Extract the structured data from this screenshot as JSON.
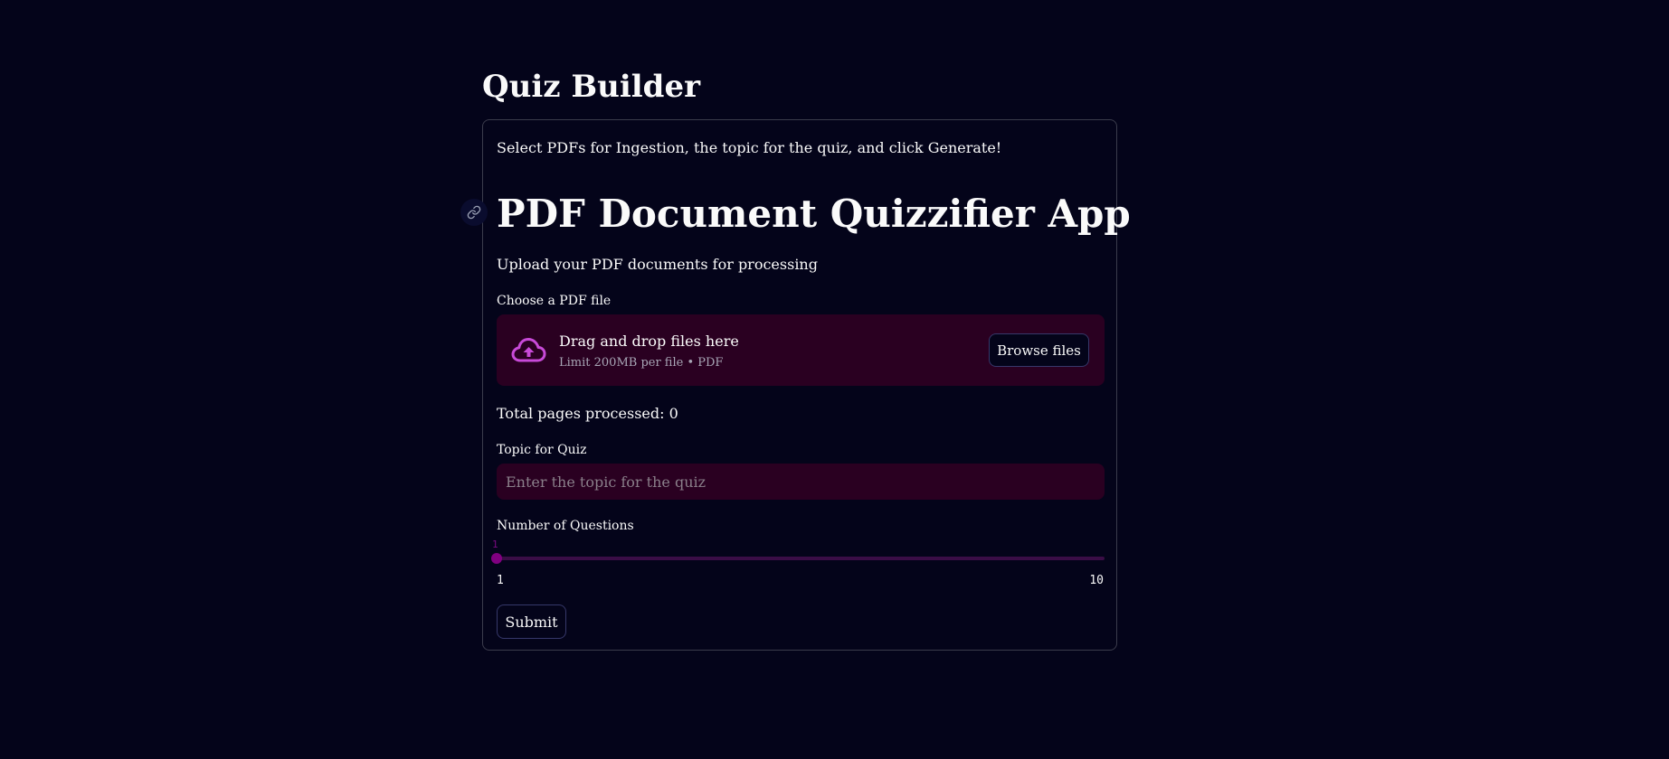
{
  "page": {
    "title": "Quiz Builder"
  },
  "form": {
    "intro": "Select PDFs for Ingestion, the topic for the quiz, and click Generate!",
    "heading": "PDF Document Quizzifier App",
    "subtitle": "Upload your PDF documents for processing",
    "file_label": "Choose a PDF file",
    "dropzone": {
      "title": "Drag and drop files here",
      "limit": "Limit 200MB per file • PDF",
      "browse_label": "Browse files",
      "icon": "cloud-upload-icon"
    },
    "pages_processed": "Total pages processed: 0",
    "topic": {
      "label": "Topic for Quiz",
      "value": "",
      "placeholder": "Enter the topic for the quiz"
    },
    "questions": {
      "label": "Number of Questions",
      "value": "1",
      "min": "1",
      "max": "10",
      "fraction": 0
    },
    "submit_label": "Submit"
  },
  "colors": {
    "background": "#04041a",
    "accent": "#800080",
    "field_bg": "#2a0021",
    "icon": "#c84ad8"
  }
}
